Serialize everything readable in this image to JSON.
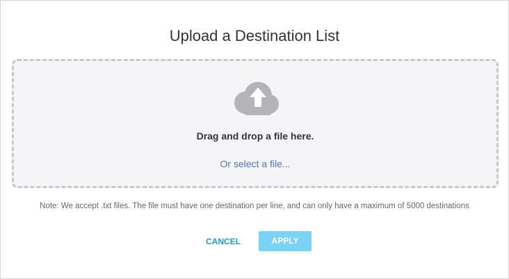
{
  "dialog": {
    "title": "Upload a Destination List",
    "dropzone": {
      "icon": "cloud-upload-icon",
      "instruction": "Drag and drop a file here.",
      "select_link": "Or select a file..."
    },
    "note": "Note: We accept .txt files. The file must have one destination per line, and can only have a maximum of 5000 destinations",
    "buttons": {
      "cancel_label": "CANCEL",
      "apply_label": "APPLY"
    }
  },
  "colors": {
    "link": "#4b75c8",
    "cancel": "#1a9ad6",
    "apply_bg": "#7ad2f5",
    "dropzone_bg": "#f5f5f8",
    "dropzone_border": "#c7c7cc",
    "cloud": "#b3b3b8"
  }
}
